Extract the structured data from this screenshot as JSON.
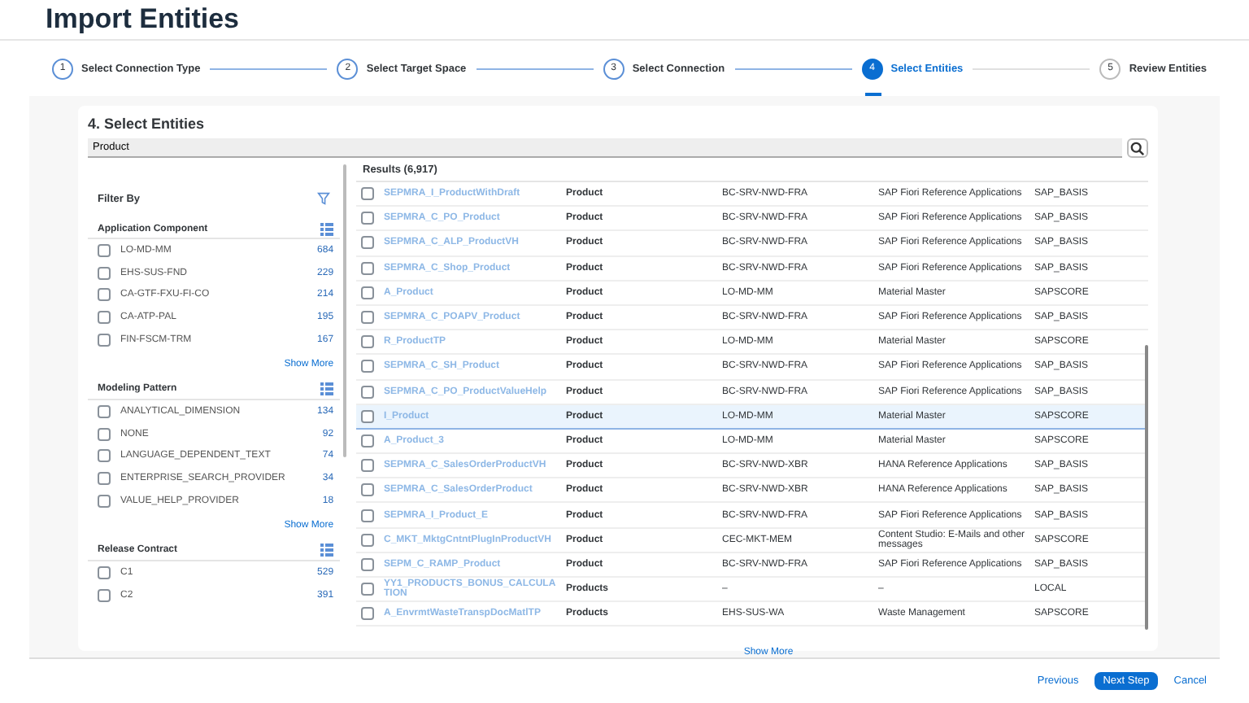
{
  "page_title": "Import Entities",
  "steps": [
    {
      "number": "1",
      "label": "Select Connection Type",
      "completed": true,
      "selected": false
    },
    {
      "number": "2",
      "label": "Select Target Space",
      "completed": true,
      "selected": false
    },
    {
      "number": "3",
      "label": "Select Connection",
      "completed": true,
      "selected": false
    },
    {
      "number": "4",
      "label": "Select Entities",
      "completed": false,
      "selected": true
    },
    {
      "number": "5",
      "label": "Review Entities",
      "completed": false,
      "selected": false
    }
  ],
  "section_title": "4. Select Entities",
  "search": {
    "value": "Product"
  },
  "filter": {
    "title": "Filter By",
    "groups": [
      {
        "title": "Application Component",
        "items": [
          {
            "label": "LO-MD-MM",
            "count": "684",
            "checked": false
          },
          {
            "label": "EHS-SUS-FND",
            "count": "229",
            "checked": false
          },
          {
            "label": "CA-GTF-FXU-FI-CO",
            "count": "214",
            "checked": false
          },
          {
            "label": "CA-ATP-PAL",
            "count": "195",
            "checked": false
          },
          {
            "label": "FIN-FSCM-TRM",
            "count": "167",
            "checked": false
          }
        ],
        "show_more": "Show More"
      },
      {
        "title": "Modeling Pattern",
        "items": [
          {
            "label": "ANALYTICAL_DIMENSION",
            "count": "134",
            "checked": false
          },
          {
            "label": "NONE",
            "count": "92",
            "checked": false
          },
          {
            "label": "LANGUAGE_DEPENDENT_TEXT",
            "count": "74",
            "checked": false
          },
          {
            "label": "ENTERPRISE_SEARCH_PROVIDER",
            "count": "34",
            "checked": false
          },
          {
            "label": "VALUE_HELP_PROVIDER",
            "count": "18",
            "checked": false
          }
        ],
        "show_more": "Show More"
      },
      {
        "title": "Release Contract",
        "items": [
          {
            "label": "C1",
            "count": "529",
            "checked": false
          },
          {
            "label": "C2",
            "count": "391",
            "checked": false
          }
        ]
      }
    ]
  },
  "results": {
    "title": "Results (6,917)",
    "rows": [
      {
        "cells": [
          "SEPMRA_I_ProductWithDraft",
          "Product",
          "BC-SRV-NWD-FRA",
          "SAP Fiori Reference Applications",
          "SAP_BASIS"
        ],
        "selected": false,
        "checked": false
      },
      {
        "cells": [
          "SEPMRA_C_PO_Product",
          "Product",
          "BC-SRV-NWD-FRA",
          "SAP Fiori Reference Applications",
          "SAP_BASIS"
        ],
        "selected": false,
        "checked": false
      },
      {
        "cells": [
          "SEPMRA_C_ALP_ProductVH",
          "Product",
          "BC-SRV-NWD-FRA",
          "SAP Fiori Reference Applications",
          "SAP_BASIS"
        ],
        "selected": false,
        "checked": false
      },
      {
        "cells": [
          "SEPMRA_C_Shop_Product",
          "Product",
          "BC-SRV-NWD-FRA",
          "SAP Fiori Reference Applications",
          "SAP_BASIS"
        ],
        "selected": false,
        "checked": false
      },
      {
        "cells": [
          "A_Product",
          "Product",
          "LO-MD-MM",
          "Material Master",
          "SAPSCORE"
        ],
        "selected": false,
        "checked": false
      },
      {
        "cells": [
          "SEPMRA_C_POAPV_Product",
          "Product",
          "BC-SRV-NWD-FRA",
          "SAP Fiori Reference Applications",
          "SAP_BASIS"
        ],
        "selected": false,
        "checked": false
      },
      {
        "cells": [
          "R_ProductTP",
          "Product",
          "LO-MD-MM",
          "Material Master",
          "SAPSCORE"
        ],
        "selected": false,
        "checked": false
      },
      {
        "cells": [
          "SEPMRA_C_SH_Product",
          "Product",
          "BC-SRV-NWD-FRA",
          "SAP Fiori Reference Applications",
          "SAP_BASIS"
        ],
        "selected": false,
        "checked": false
      },
      {
        "cells": [
          "SEPMRA_C_PO_ProductValueHelp",
          "Product",
          "BC-SRV-NWD-FRA",
          "SAP Fiori Reference Applications",
          "SAP_BASIS"
        ],
        "selected": false,
        "checked": false
      },
      {
        "cells": [
          "I_Product",
          "Product",
          "LO-MD-MM",
          "Material Master",
          "SAPSCORE"
        ],
        "selected": true,
        "checked": false
      },
      {
        "cells": [
          "A_Product_3",
          "Product",
          "LO-MD-MM",
          "Material Master",
          "SAPSCORE"
        ],
        "selected": false,
        "checked": false
      },
      {
        "cells": [
          "SEPMRA_C_SalesOrderProductVH",
          "Product",
          "BC-SRV-NWD-XBR",
          "HANA Reference Applications",
          "SAP_BASIS"
        ],
        "selected": false,
        "checked": false
      },
      {
        "cells": [
          "SEPMRA_C_SalesOrderProduct",
          "Product",
          "BC-SRV-NWD-XBR",
          "HANA Reference Applications",
          "SAP_BASIS"
        ],
        "selected": false,
        "checked": false
      },
      {
        "cells": [
          "SEPMRA_I_Product_E",
          "Product",
          "BC-SRV-NWD-FRA",
          "SAP Fiori Reference Applications",
          "SAP_BASIS"
        ],
        "selected": false,
        "checked": false
      },
      {
        "cells": [
          "C_MKT_MktgCntntPlugInProductVH",
          "Product",
          "CEC-MKT-MEM",
          "Content Studio: E-Mails and other messages",
          "SAPSCORE"
        ],
        "selected": false,
        "checked": false
      },
      {
        "cells": [
          "SEPM_C_RAMP_Product",
          "Product",
          "BC-SRV-NWD-FRA",
          "SAP Fiori Reference Applications",
          "SAP_BASIS"
        ],
        "selected": false,
        "checked": false
      },
      {
        "cells": [
          "YY1_PRODUCTS_BONUS_CALCULATION",
          "Products",
          "–",
          "–",
          "LOCAL"
        ],
        "selected": false,
        "checked": false
      },
      {
        "cells": [
          "A_EnvrmtWasteTranspDocMatlTP",
          "Products",
          "EHS-SUS-WA",
          "Waste Management",
          "SAPSCORE"
        ],
        "selected": false,
        "checked": false
      }
    ],
    "show_more": "Show More"
  },
  "footer": {
    "buttons": [
      {
        "label": "Previous",
        "kind": "link"
      },
      {
        "label": "Next Step",
        "kind": "primary"
      },
      {
        "label": "Cancel",
        "kind": "link"
      }
    ]
  }
}
